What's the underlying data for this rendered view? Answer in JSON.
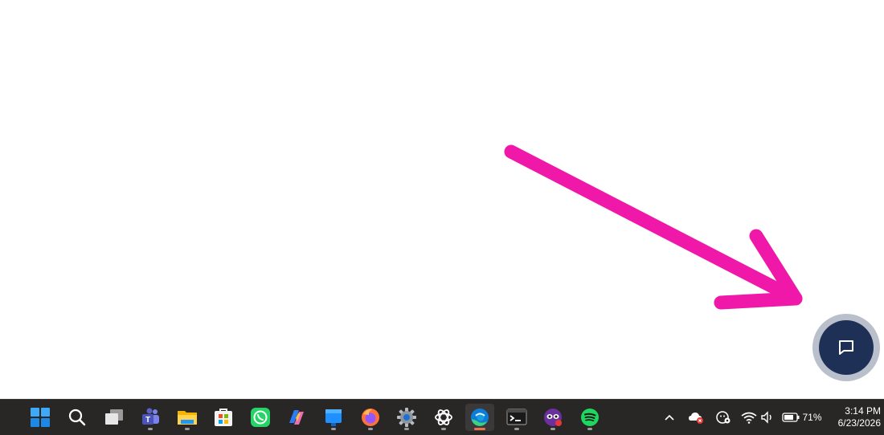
{
  "annotation": {
    "color": "#f018a8"
  },
  "chat_button": {
    "icon": "chat-bubble-icon",
    "color": "#1f3057",
    "ring_color": "#b9c0cc"
  },
  "taskbar": {
    "apps": [
      {
        "name": "start",
        "icon": "windows-start-icon"
      },
      {
        "name": "search",
        "icon": "search-icon"
      },
      {
        "name": "task-view",
        "icon": "task-view-icon"
      },
      {
        "name": "teams",
        "icon": "teams-icon"
      },
      {
        "name": "file-explorer",
        "icon": "folder-icon"
      },
      {
        "name": "microsoft-store",
        "icon": "store-icon"
      },
      {
        "name": "whatsapp",
        "icon": "whatsapp-icon"
      },
      {
        "name": "copilot",
        "icon": "copilot-icon"
      },
      {
        "name": "blue-app",
        "icon": "blue-app-icon"
      },
      {
        "name": "firefox",
        "icon": "firefox-icon"
      },
      {
        "name": "settings",
        "icon": "gear-icon"
      },
      {
        "name": "chatgpt",
        "icon": "chatgpt-icon"
      },
      {
        "name": "edge",
        "icon": "edge-icon",
        "active": true
      },
      {
        "name": "terminal",
        "icon": "terminal-icon"
      },
      {
        "name": "mask-app",
        "icon": "mask-icon"
      },
      {
        "name": "spotify",
        "icon": "spotify-icon"
      }
    ],
    "tray": {
      "battery_percent": "71%",
      "time": "3:14 PM",
      "date": "6/23/2026"
    }
  }
}
